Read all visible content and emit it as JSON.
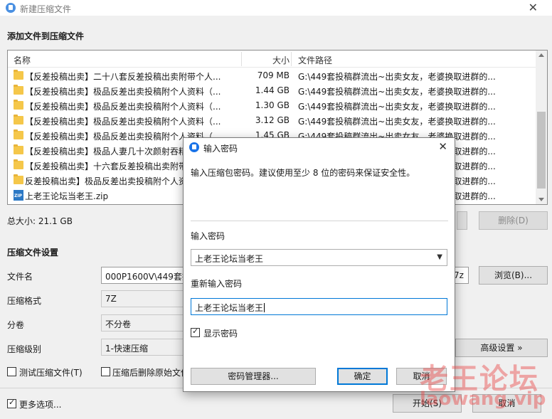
{
  "window": {
    "title": "新建压缩文件"
  },
  "add_section": {
    "title": "添加文件到压缩文件"
  },
  "file_list": {
    "columns": {
      "name": "名称",
      "size": "大小",
      "path": "文件路径"
    },
    "rows": [
      {
        "type": "folder",
        "name": "【反差投稿出卖】二十八套反差投稿出卖附带个人...",
        "size": "709 MB",
        "path": "G:\\449套投稿群流出~出卖女友，老婆换取进群的..."
      },
      {
        "type": "folder",
        "name": "【反差投稿出卖】极品反差出卖投稿附个人资料（...",
        "size": "1.44 GB",
        "path": "G:\\449套投稿群流出~出卖女友，老婆换取进群的..."
      },
      {
        "type": "folder",
        "name": "【反差投稿出卖】极品反差出卖投稿附个人资料（...",
        "size": "1.30 GB",
        "path": "G:\\449套投稿群流出~出卖女友，老婆换取进群的..."
      },
      {
        "type": "folder",
        "name": "【反差投稿出卖】极品反差出卖投稿附个人资料（...",
        "size": "3.12 GB",
        "path": "G:\\449套投稿群流出~出卖女友，老婆换取进群的..."
      },
      {
        "type": "folder",
        "name": "【反差投稿出卖】极品反差出卖投稿附个人资料（...",
        "size": "1.45 GB",
        "path": "G:\\449套投稿群流出~出卖女友，老婆换取进群的..."
      },
      {
        "type": "folder",
        "name": "【反差投稿出卖】极品人妻几十次颜射吞精...",
        "size": "",
        "path": "G:\\449套投稿群流出~出卖女友，老婆换取进群的..."
      },
      {
        "type": "folder",
        "name": "【反差投稿出卖】十六套反差投稿出卖附带...",
        "size": "",
        "path": "G:\\449套投稿群流出~出卖女友，老婆换取进群的..."
      },
      {
        "type": "folder",
        "name": "反差投稿出卖】极品反差出卖投稿附个人资...",
        "size": "",
        "path": "G:\\449套投稿群流出~出卖女友，老婆换取进群的..."
      },
      {
        "type": "zip",
        "name": "上老王论坛当老王.zip",
        "size": "",
        "path": "G:\\449套投稿群流出~出卖女友，老婆换取进群的..."
      }
    ]
  },
  "total_size": "总大小: 21.1 GB",
  "delete_button": "删除(D)",
  "settings": {
    "title": "压缩文件设置",
    "filename_label": "文件名",
    "filename_value": "000P1600V\\449套投稿群流出~出卖女友，老婆换取进群的反差投稿出卖.7z",
    "filename_tail": "7z",
    "browse_button": "浏览(B)...",
    "format_label": "压缩格式",
    "format_value": "7Z",
    "split_label": "分卷",
    "split_value": "不分卷",
    "level_label": "压缩级别",
    "level_value": "1-快速压缩",
    "advanced_button": "高级设置 »",
    "test_checkbox": "测试压缩文件(T)",
    "delete_after_checkbox": "压缩后删除原始文件",
    "more_options": "更多选项...",
    "start_button": "开始(S)",
    "cancel_button": "取消"
  },
  "dialog": {
    "title": "输入密码",
    "hint": "输入压缩包密码。建议使用至少 8 位的密码来保证安全性。",
    "password_label": "输入密码",
    "password_value": "上老王论坛当老王",
    "confirm_label": "重新输入密码",
    "confirm_value": "上老王论坛当老王",
    "show_password": "显示密码",
    "manager_button": "密码管理器...",
    "ok_button": "确定",
    "cancel_button": "取消"
  },
  "watermark": {
    "title": "老王论坛",
    "url": "laowang.vip"
  }
}
